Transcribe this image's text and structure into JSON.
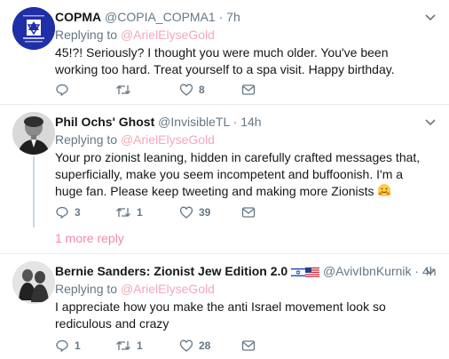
{
  "tweets": [
    {
      "name": "COPMA",
      "handle": "@COPIA_COPMA1",
      "time": "7h",
      "replying_prefix": "Replying to",
      "mention": "@ArielElyseGold",
      "text": "45!?! Seriously? I thought you were much older. You've been working too hard. Treat yourself to a spa visit. Happy birthday.",
      "reply_count": "",
      "retweet_count": "",
      "like_count": "8"
    },
    {
      "name": "Phil Ochs' Ghost",
      "handle": "@InvisibleTL",
      "time": "14h",
      "replying_prefix": "Replying to",
      "mention": "@ArielElyseGold",
      "text": "Your pro zionist leaning, hidden in carefully crafted messages that, superficially, make you seem incompetent and buffoonish. I'm a huge fan. Please keep tweeting and making more Zionists",
      "reply_count": "3",
      "retweet_count": "1",
      "like_count": "39",
      "more_replies": "1 more reply"
    },
    {
      "name": "Bernie Sanders: Zionist Jew Edition 2.0",
      "handle": "@AvivIbnKurnik",
      "time": "4h",
      "replying_prefix": "Replying to",
      "mention": "@ArielElyseGold",
      "text": "I appreciate how you make the anti Israel movement look so rediculous and crazy",
      "reply_count": "1",
      "retweet_count": "1",
      "like_count": "28"
    }
  ],
  "colors": {
    "link": "#f28aa4",
    "secondary": "#657786",
    "divider": "#e6ecf0"
  }
}
